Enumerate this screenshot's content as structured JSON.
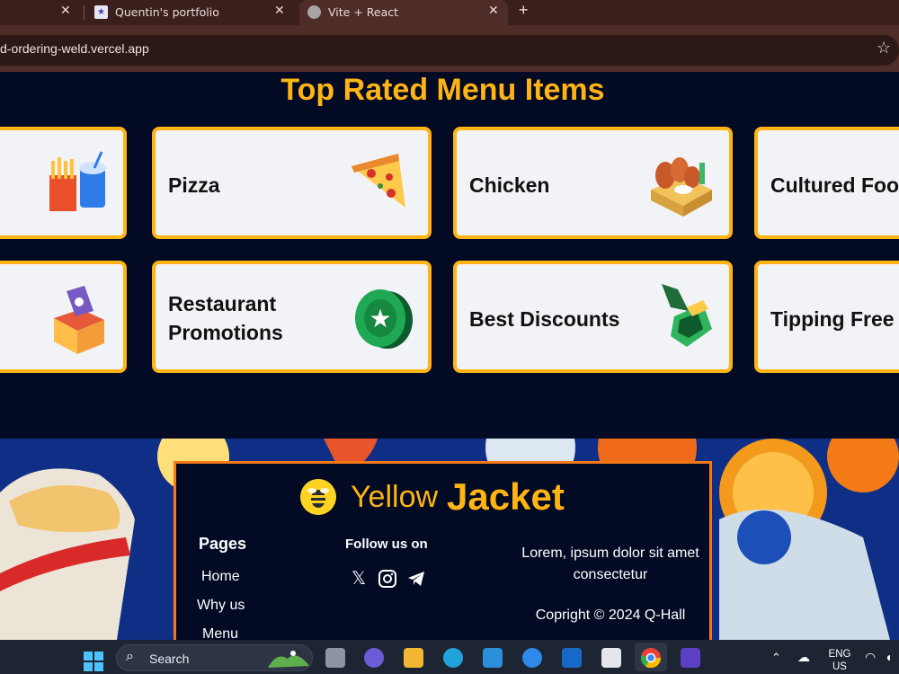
{
  "browser": {
    "tabs": [
      {
        "label": "",
        "close": "✕"
      },
      {
        "label": "Quentin's portfolio",
        "close": "✕"
      },
      {
        "label": "Vite + React",
        "close": "✕"
      }
    ],
    "new_tab": "+",
    "url": "d-ordering-weld.vercel.app",
    "bookmark_icon": "star-icon"
  },
  "page": {
    "heading": "Top Rated Menu Items",
    "row1": [
      {
        "title": "",
        "icon": "fries-and-drink-icon"
      },
      {
        "title": "Pizza",
        "icon": "pizza-slice-icon"
      },
      {
        "title": "Chicken",
        "icon": "chicken-wings-icon"
      },
      {
        "title": "Cultured Foo",
        "icon": ""
      }
    ],
    "row2": [
      {
        "title": "",
        "icon": "shop-tag-icon"
      },
      {
        "title": "Restaurant Promotions",
        "icon": "star-coin-icon"
      },
      {
        "title": "Best Discounts",
        "icon": "discount-tag-icon"
      },
      {
        "title": "Tipping Free",
        "icon": ""
      }
    ]
  },
  "footer": {
    "brand_light": "Yellow",
    "brand_bold": "Jacket",
    "pages_title": "Pages",
    "links": [
      "Home",
      "Why us",
      "Menu"
    ],
    "follow_title": "Follow us on",
    "social_icons": [
      "x-icon",
      "instagram-icon",
      "telegram-icon"
    ],
    "tagline": "Lorem, ipsum dolor sit amet consectetur",
    "copyright": "Copright © 2024 Q-Hall"
  },
  "taskbar": {
    "search_label": "Search",
    "lang_line1": "ENG",
    "lang_line2": "US",
    "colors": {
      "accent": "#ffb414",
      "orange": "#f47a18",
      "navy": "#020a24"
    }
  }
}
